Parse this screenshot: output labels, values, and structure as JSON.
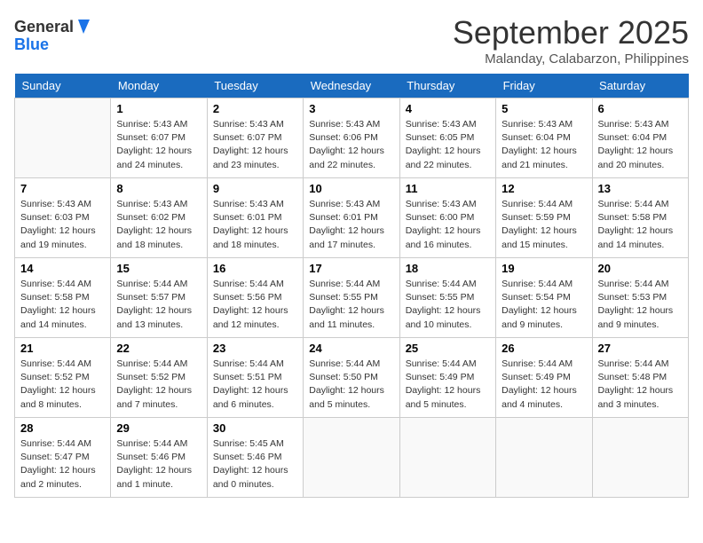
{
  "header": {
    "logo_line1": "General",
    "logo_line2": "Blue",
    "month": "September 2025",
    "location": "Malanday, Calabarzon, Philippines"
  },
  "days_of_week": [
    "Sunday",
    "Monday",
    "Tuesday",
    "Wednesday",
    "Thursday",
    "Friday",
    "Saturday"
  ],
  "weeks": [
    [
      {
        "num": "",
        "info": ""
      },
      {
        "num": "1",
        "info": "Sunrise: 5:43 AM\nSunset: 6:07 PM\nDaylight: 12 hours\nand 24 minutes."
      },
      {
        "num": "2",
        "info": "Sunrise: 5:43 AM\nSunset: 6:07 PM\nDaylight: 12 hours\nand 23 minutes."
      },
      {
        "num": "3",
        "info": "Sunrise: 5:43 AM\nSunset: 6:06 PM\nDaylight: 12 hours\nand 22 minutes."
      },
      {
        "num": "4",
        "info": "Sunrise: 5:43 AM\nSunset: 6:05 PM\nDaylight: 12 hours\nand 22 minutes."
      },
      {
        "num": "5",
        "info": "Sunrise: 5:43 AM\nSunset: 6:04 PM\nDaylight: 12 hours\nand 21 minutes."
      },
      {
        "num": "6",
        "info": "Sunrise: 5:43 AM\nSunset: 6:04 PM\nDaylight: 12 hours\nand 20 minutes."
      }
    ],
    [
      {
        "num": "7",
        "info": "Sunrise: 5:43 AM\nSunset: 6:03 PM\nDaylight: 12 hours\nand 19 minutes."
      },
      {
        "num": "8",
        "info": "Sunrise: 5:43 AM\nSunset: 6:02 PM\nDaylight: 12 hours\nand 18 minutes."
      },
      {
        "num": "9",
        "info": "Sunrise: 5:43 AM\nSunset: 6:01 PM\nDaylight: 12 hours\nand 18 minutes."
      },
      {
        "num": "10",
        "info": "Sunrise: 5:43 AM\nSunset: 6:01 PM\nDaylight: 12 hours\nand 17 minutes."
      },
      {
        "num": "11",
        "info": "Sunrise: 5:43 AM\nSunset: 6:00 PM\nDaylight: 12 hours\nand 16 minutes."
      },
      {
        "num": "12",
        "info": "Sunrise: 5:44 AM\nSunset: 5:59 PM\nDaylight: 12 hours\nand 15 minutes."
      },
      {
        "num": "13",
        "info": "Sunrise: 5:44 AM\nSunset: 5:58 PM\nDaylight: 12 hours\nand 14 minutes."
      }
    ],
    [
      {
        "num": "14",
        "info": "Sunrise: 5:44 AM\nSunset: 5:58 PM\nDaylight: 12 hours\nand 14 minutes."
      },
      {
        "num": "15",
        "info": "Sunrise: 5:44 AM\nSunset: 5:57 PM\nDaylight: 12 hours\nand 13 minutes."
      },
      {
        "num": "16",
        "info": "Sunrise: 5:44 AM\nSunset: 5:56 PM\nDaylight: 12 hours\nand 12 minutes."
      },
      {
        "num": "17",
        "info": "Sunrise: 5:44 AM\nSunset: 5:55 PM\nDaylight: 12 hours\nand 11 minutes."
      },
      {
        "num": "18",
        "info": "Sunrise: 5:44 AM\nSunset: 5:55 PM\nDaylight: 12 hours\nand 10 minutes."
      },
      {
        "num": "19",
        "info": "Sunrise: 5:44 AM\nSunset: 5:54 PM\nDaylight: 12 hours\nand 9 minutes."
      },
      {
        "num": "20",
        "info": "Sunrise: 5:44 AM\nSunset: 5:53 PM\nDaylight: 12 hours\nand 9 minutes."
      }
    ],
    [
      {
        "num": "21",
        "info": "Sunrise: 5:44 AM\nSunset: 5:52 PM\nDaylight: 12 hours\nand 8 minutes."
      },
      {
        "num": "22",
        "info": "Sunrise: 5:44 AM\nSunset: 5:52 PM\nDaylight: 12 hours\nand 7 minutes."
      },
      {
        "num": "23",
        "info": "Sunrise: 5:44 AM\nSunset: 5:51 PM\nDaylight: 12 hours\nand 6 minutes."
      },
      {
        "num": "24",
        "info": "Sunrise: 5:44 AM\nSunset: 5:50 PM\nDaylight: 12 hours\nand 5 minutes."
      },
      {
        "num": "25",
        "info": "Sunrise: 5:44 AM\nSunset: 5:49 PM\nDaylight: 12 hours\nand 5 minutes."
      },
      {
        "num": "26",
        "info": "Sunrise: 5:44 AM\nSunset: 5:49 PM\nDaylight: 12 hours\nand 4 minutes."
      },
      {
        "num": "27",
        "info": "Sunrise: 5:44 AM\nSunset: 5:48 PM\nDaylight: 12 hours\nand 3 minutes."
      }
    ],
    [
      {
        "num": "28",
        "info": "Sunrise: 5:44 AM\nSunset: 5:47 PM\nDaylight: 12 hours\nand 2 minutes."
      },
      {
        "num": "29",
        "info": "Sunrise: 5:44 AM\nSunset: 5:46 PM\nDaylight: 12 hours\nand 1 minute."
      },
      {
        "num": "30",
        "info": "Sunrise: 5:45 AM\nSunset: 5:46 PM\nDaylight: 12 hours\nand 0 minutes."
      },
      {
        "num": "",
        "info": ""
      },
      {
        "num": "",
        "info": ""
      },
      {
        "num": "",
        "info": ""
      },
      {
        "num": "",
        "info": ""
      }
    ]
  ]
}
